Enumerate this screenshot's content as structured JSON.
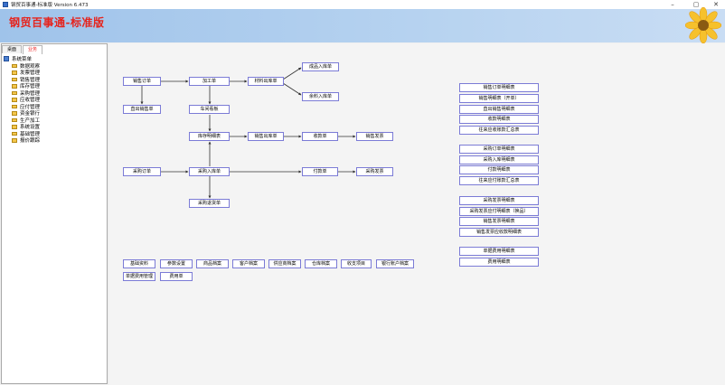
{
  "window": {
    "title": "钢贸百事通-标准版 Version 6.473",
    "min_icon": "minimize-icon",
    "max_icon": "maximize-icon",
    "close_icon": "close-icon"
  },
  "banner": {
    "brand": "钢贸百事通-标准版"
  },
  "tabs": [
    "桌面",
    "业务"
  ],
  "tree": {
    "root": "系统菜单",
    "items": [
      "数据观察",
      "发票管理",
      "销售管理",
      "库存管理",
      "采购管理",
      "应收管理",
      "应付管理",
      "资金银行",
      "生产加工",
      "系统设置",
      "基础管理",
      "报价跟踪"
    ]
  },
  "flow": {
    "sales_order": "销售订单",
    "direct_sales": "直出销售单",
    "processing": "加工单",
    "workshop": "车间看板",
    "material_out": "材料出库单",
    "product_in": "成品入库单",
    "scrap_in": "余料入库单",
    "stock_detail": "库存明细表",
    "sales_out": "销售出库单",
    "receipt": "收款单",
    "sales_invoice": "销售发票",
    "purchase_order": "采购订单",
    "purchase_in": "采购入库单",
    "payment": "付款单",
    "purchase_invoice": "采购发票",
    "purchase_return": "采购退货单"
  },
  "bottom_buttons": [
    "基础资料",
    "参数设置",
    "商品档案",
    "客户档案",
    "供应商档案",
    "仓库档案",
    "收支项目",
    "银行账户档案",
    "单据费用管理",
    "费用单"
  ],
  "reports": [
    "销售订单明细表",
    "销售明细表（开单）",
    "直出销售明细表",
    "收款明细表",
    "往来应收账款汇总表",
    "采购订单明细表",
    "采购入库明细表",
    "付款明细表",
    "往来应付账款汇总表",
    "采购发票明细表",
    "采购发票应付明细表（换品）",
    "销售发票明细表",
    "销售发票应收款明细表",
    "单据费用明细表",
    "费用明细表"
  ]
}
